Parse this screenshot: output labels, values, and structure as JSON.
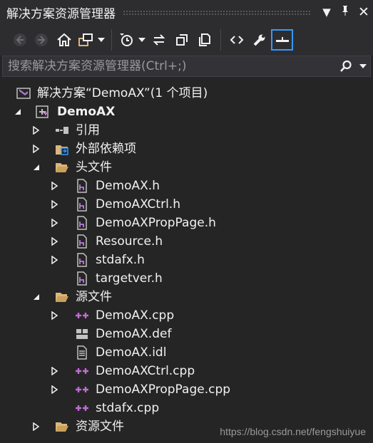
{
  "window": {
    "title": "解决方案资源管理器"
  },
  "search": {
    "placeholder": "搜索解决方案资源管理器(Ctrl+;)"
  },
  "tree": {
    "solution": "解决方案“DemoAX”(1 个项目)",
    "project": "DemoAX",
    "references": "引用",
    "external_deps": "外部依赖项",
    "header_folder": "头文件",
    "headers": [
      "DemoAX.h",
      "DemoAXCtrl.h",
      "DemoAXPropPage.h",
      "Resource.h",
      "stdafx.h",
      "targetver.h"
    ],
    "source_folder": "源文件",
    "sources": [
      "DemoAX.cpp",
      "DemoAX.def",
      "DemoAX.idl",
      "DemoAXCtrl.cpp",
      "DemoAXPropPage.cpp",
      "stdafx.cpp"
    ],
    "resource_folder": "资源文件"
  },
  "watermark": "https://blog.csdn.net/fengshuiyue",
  "colors": {
    "background": "#252526",
    "accent": "#3399ff",
    "cpp_icon": "#c16cd6",
    "header_icon": "#b880d8",
    "folder": "#dcb67a"
  }
}
